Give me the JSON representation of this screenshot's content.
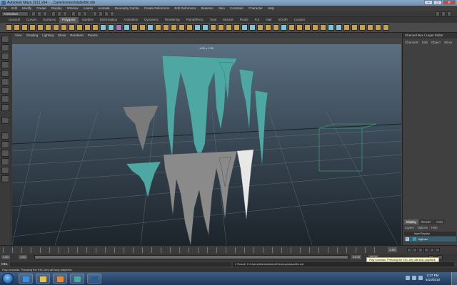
{
  "window": {
    "title": "Autodesk Maya 2011 x64 - ...Cave/scenes/stalactite.mb",
    "btn_min": "–",
    "btn_max": "□",
    "btn_close": "✕"
  },
  "menubar": [
    "File",
    "Edit",
    "Modify",
    "Create",
    "Display",
    "Window",
    "Assets",
    "Animate",
    "Geometry Cache",
    "Create Deformers",
    "Edit Deformers",
    "Skeleton",
    "Skin",
    "Constrain",
    "Character",
    "Help"
  ],
  "statusline": {
    "mode": "Animation"
  },
  "shelf": {
    "tabs": [
      "General",
      "Curves",
      "Surfaces",
      "Polygons",
      "Subdivs",
      "Deformation",
      "Animation",
      "Dynamics",
      "Rendering",
      "PaintEffects",
      "Toon",
      "Muscle",
      "Fluids",
      "Fur",
      "Hair",
      "nCloth",
      "Custom"
    ],
    "active_tab": "Polygons",
    "icon_colors": [
      "#c9a046",
      "#c9a046",
      "#c9a046",
      "#c9a046",
      "#c9a046",
      "#c9a046",
      "#c9a046",
      "#c9a046",
      "#c9a046",
      "#c9a046",
      "#c9a046",
      "#c9a046",
      "#7cc6d6",
      "#7cc6d6",
      "#b070c8",
      "#7cc6d6",
      "#c9a046",
      "#c9a046",
      "#7cc6d6",
      "#c9a046",
      "#c9a046",
      "#c9a046",
      "#c9a046",
      "#c9a046",
      "#7cc6d6",
      "#7cc6d6",
      "#c9a046",
      "#c9a046",
      "#c9a046",
      "#c9a046",
      "#7cc6d6",
      "#7cc6d6",
      "#c9a046",
      "#c9a046",
      "#c9a046",
      "#7cc6d6",
      "#c9a046",
      "#c9a046",
      "#c9a046",
      "#c9a046",
      "#c9a046",
      "#7cc6d6",
      "#7cc6d6",
      "#c9a046",
      "#c9a046",
      "#c9a046",
      "#c9a046",
      "#c9a046",
      "#c9a046"
    ]
  },
  "panel_menu": [
    "View",
    "Shading",
    "Lighting",
    "Show",
    "Renderer",
    "Panels"
  ],
  "viewport": {
    "camera_label": "1.00 x 1.00",
    "accent_teal": "#4fa7a3",
    "accent_gray": "#8a8a8a"
  },
  "channel_box": {
    "title": "Channel Box / Layer Editor",
    "menu": [
      "Channels",
      "Edit",
      "Object",
      "Show"
    ],
    "layer_tabs": [
      "Display",
      "Render",
      "Anim"
    ],
    "active_layer_tab": "Display",
    "layer_menu": [
      "Layers",
      "Options",
      "Help"
    ],
    "layer_header": "layerDisplay",
    "layer_row": {
      "visible": "V",
      "name": "highrez"
    }
  },
  "timeslider": {
    "current_frame": "1.00",
    "ticks_note": ""
  },
  "rangeslider": {
    "start": "1.00",
    "start2": "1.00",
    "end": "24.00",
    "end2": "48.00"
  },
  "cmdline": {
    "label": "MEL",
    "result": "// Result: C:/Users/Administrator/Desktop/stalactite.mb"
  },
  "tooltip": "Play forwards. Pressing the ESC key will stop playback.",
  "helpline": "Play forwards. Pressing the ESC key will stop playback.",
  "taskbar": {
    "time": "2:27 PM",
    "date": "6/14/2010"
  }
}
